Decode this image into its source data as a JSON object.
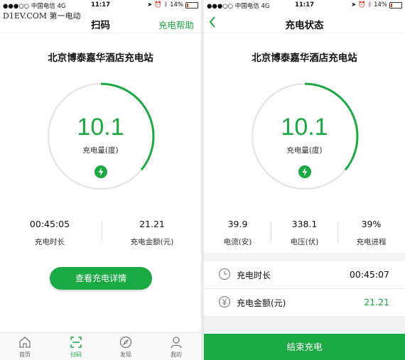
{
  "left": {
    "status": {
      "carrier": "●●●○○ 中国电信  4G",
      "time": "11:17",
      "battery": "14%"
    },
    "watermark": "D1EV.COM 第一电动",
    "nav": {
      "title": "扫码",
      "help": "充电帮助"
    },
    "station": "北京博泰嘉华酒店充电站",
    "gauge": {
      "value": "10.1",
      "label": "充电量(度)",
      "progress": 0.36
    },
    "stats": [
      {
        "value": "00:45:05",
        "label": "充电时长"
      },
      {
        "value": "21.21",
        "label": "充电金额(元)"
      }
    ],
    "details_button": "查看充电详情",
    "tabs": [
      {
        "label": "首页",
        "icon": "home-icon"
      },
      {
        "label": "扫码",
        "icon": "scan-icon"
      },
      {
        "label": "发现",
        "icon": "compass-icon"
      },
      {
        "label": "我的",
        "icon": "user-icon"
      }
    ]
  },
  "right": {
    "status": {
      "carrier": "●●●○○ 中国电信  4G",
      "time": "11:17",
      "battery": "14%"
    },
    "nav": {
      "title": "充电状态"
    },
    "station": "北京博泰嘉华酒店充电站",
    "gauge": {
      "value": "10.1",
      "label": "充电量(度)",
      "progress": 0.36
    },
    "stats": [
      {
        "value": "39.9",
        "label": "电流(安)"
      },
      {
        "value": "338.1",
        "label": "电压(伏)"
      },
      {
        "value": "39%",
        "label": "充电进程"
      }
    ],
    "rows": [
      {
        "name": "充电时长",
        "value": "00:45:07",
        "icon": "clock-icon"
      },
      {
        "name": "充电金额(元)",
        "value": "21.21",
        "icon": "yen-icon"
      }
    ],
    "end_button": "结束充电"
  },
  "colors": {
    "accent": "#1aa942",
    "ring_track": "#e6e6e6",
    "battery_low": "#e23a2f"
  }
}
